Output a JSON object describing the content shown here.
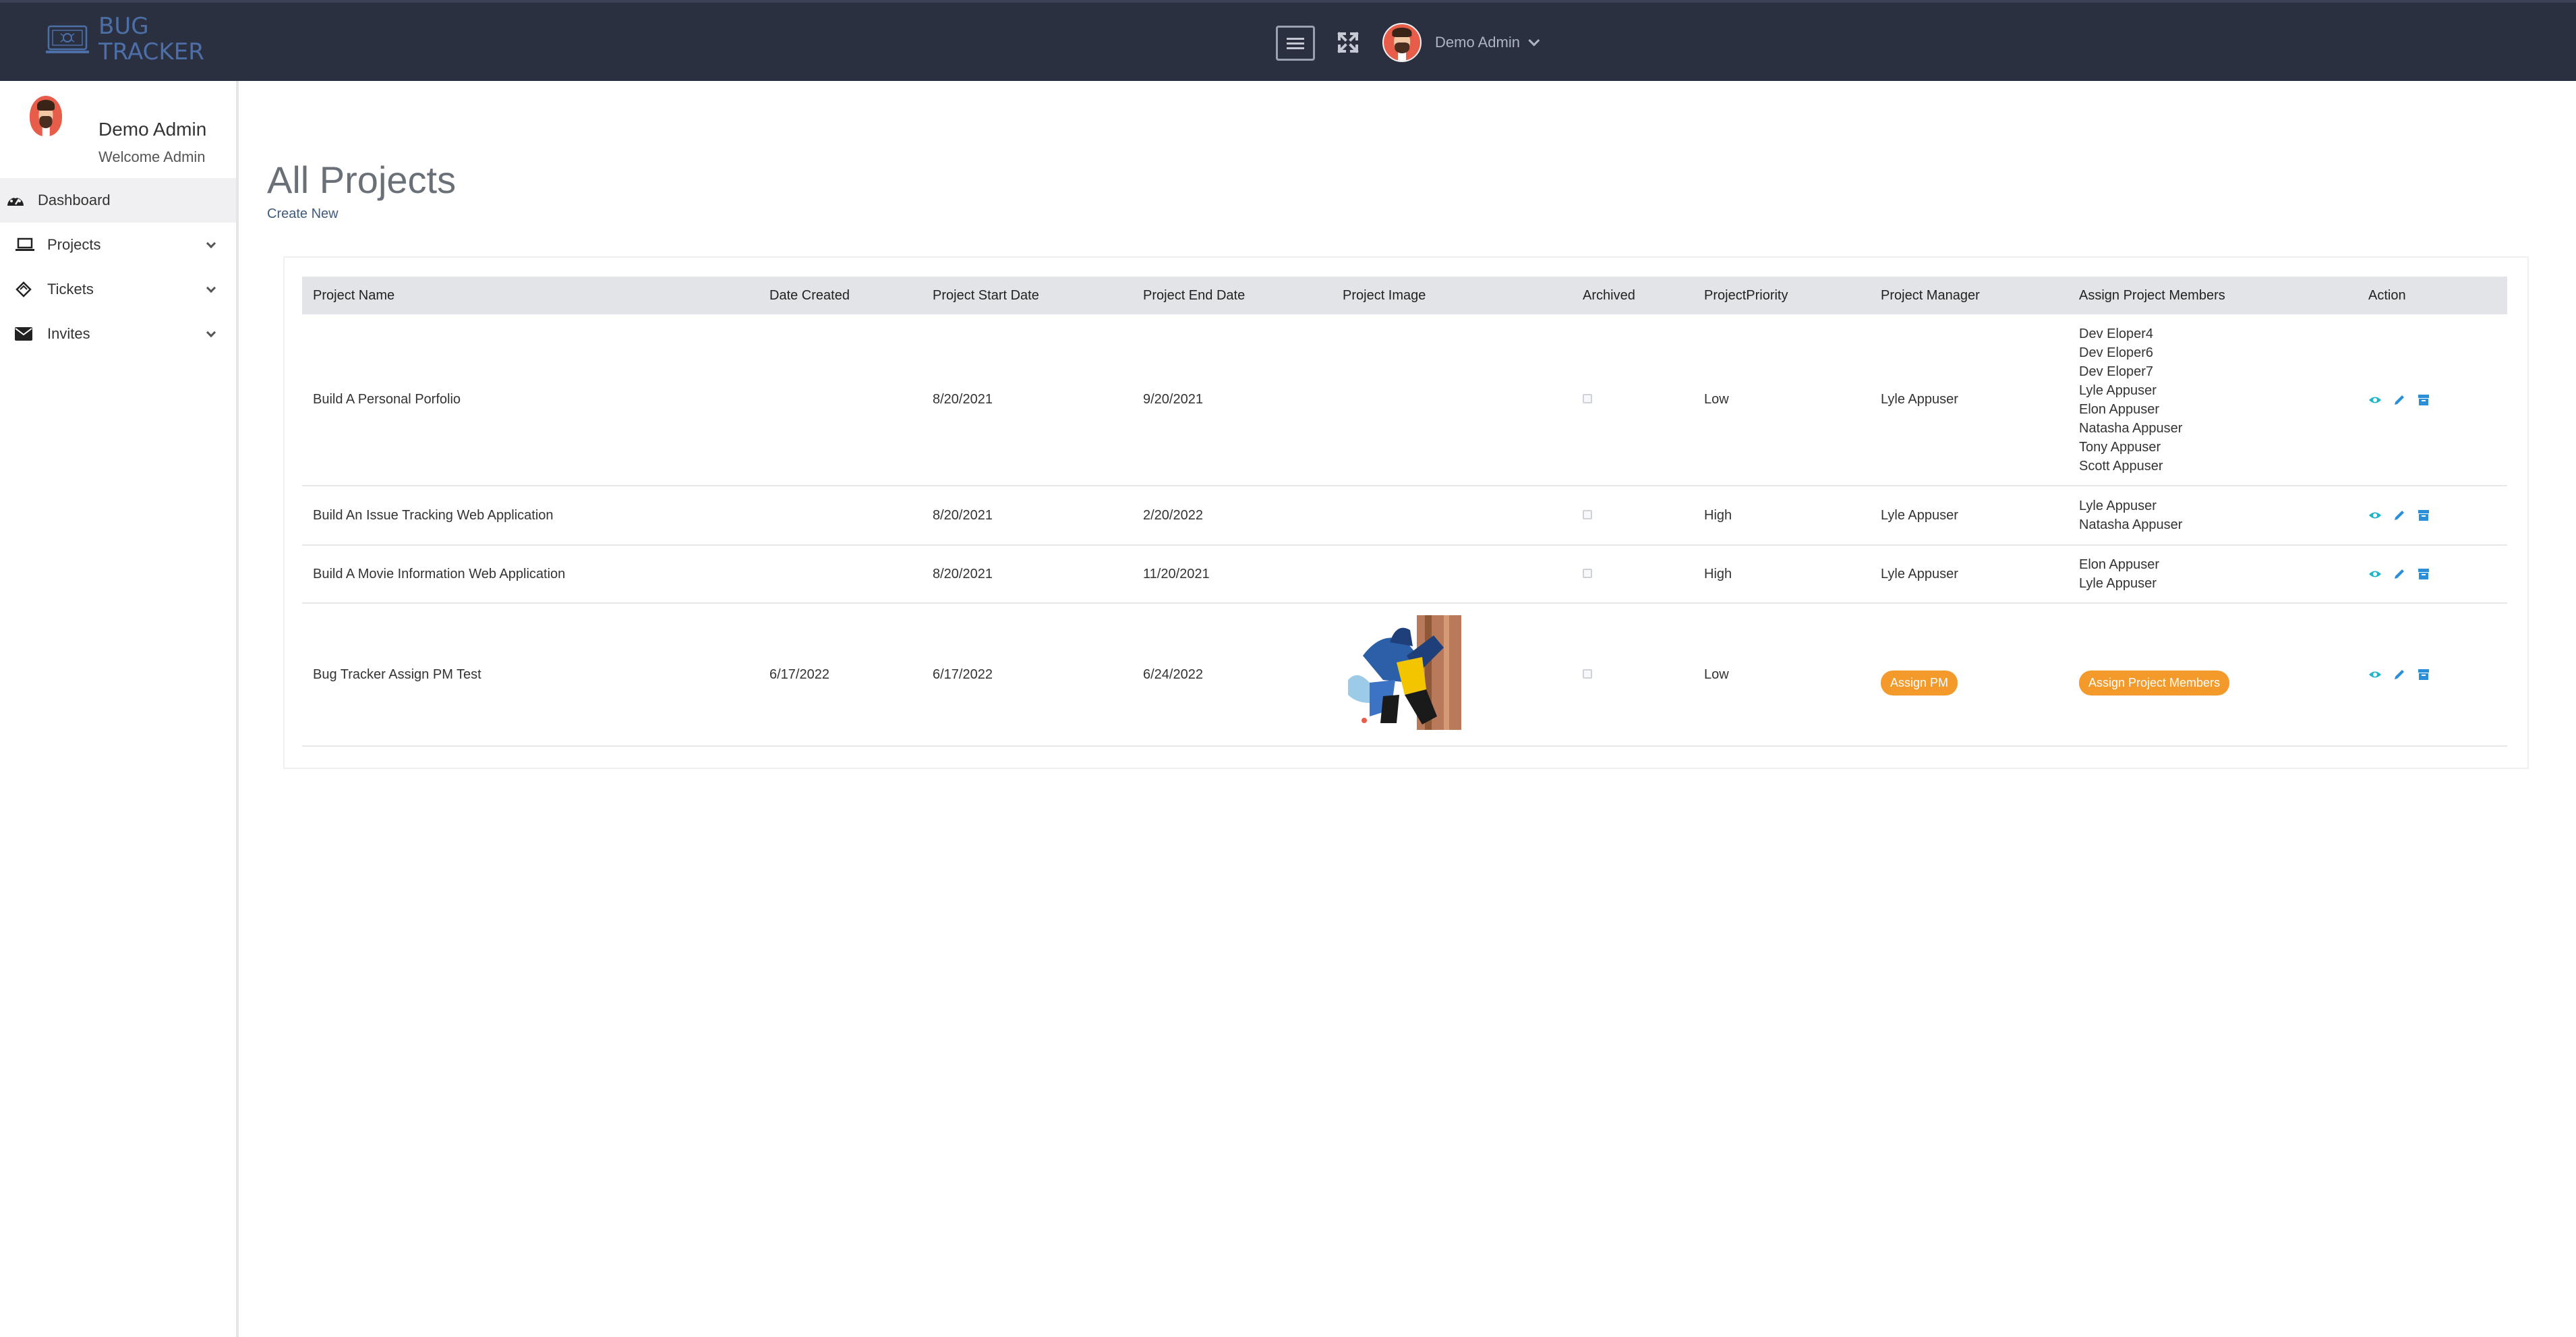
{
  "app": {
    "brand_line1": "BUG",
    "brand_line2": "TRACKER",
    "brand_icon": "bug-tracker-logo-icon"
  },
  "topbar": {
    "menu_icon": "hamburger-menu-icon",
    "fullscreen_icon": "fullscreen-icon",
    "user_name": "Demo Admin",
    "user_caret_icon": "chevron-down-icon"
  },
  "sidebar": {
    "user_name": "Demo Admin",
    "user_subtitle": "Welcome Admin",
    "items": [
      {
        "label": "Dashboard",
        "icon": "dashboard-gauge-icon",
        "active": true
      },
      {
        "label": "Projects",
        "icon": "laptop-icon",
        "expandable": true
      },
      {
        "label": "Tickets",
        "icon": "ticket-icon",
        "expandable": true
      },
      {
        "label": "Invites",
        "icon": "envelope-icon",
        "expandable": true
      }
    ]
  },
  "main": {
    "title": "All Projects",
    "create_link": "Create New",
    "table": {
      "columns": [
        "Project Name",
        "Date Created",
        "Project Start Date",
        "Project End Date",
        "Project Image",
        "Archived",
        "ProjectPriority",
        "Project Manager",
        "Assign Project Members",
        "Action"
      ],
      "rows": [
        {
          "name": "Build A Personal Porfolio",
          "created": "",
          "start": "8/20/2021",
          "end": "9/20/2021",
          "has_image": false,
          "archived": false,
          "priority": "Low",
          "manager": "Lyle Appuser",
          "members": [
            "Dev Eloper4",
            "Dev Eloper6",
            "Dev Eloper7",
            "Lyle Appuser",
            "Elon Appuser",
            "Natasha Appuser",
            "Tony Appuser",
            "Scott Appuser"
          ]
        },
        {
          "name": "Build An Issue Tracking Web Application",
          "created": "",
          "start": "8/20/2021",
          "end": "2/20/2022",
          "has_image": false,
          "archived": false,
          "priority": "High",
          "manager": "Lyle Appuser",
          "members": [
            "Lyle Appuser",
            "Natasha Appuser"
          ]
        },
        {
          "name": "Build A Movie Information Web Application",
          "created": "",
          "start": "8/20/2021",
          "end": "11/20/2021",
          "has_image": false,
          "archived": false,
          "priority": "High",
          "manager": "Lyle Appuser",
          "members": [
            "Elon Appuser",
            "Lyle Appuser"
          ]
        },
        {
          "name": "Bug Tracker Assign PM Test",
          "created": "6/17/2022",
          "start": "6/17/2022",
          "end": "6/24/2022",
          "has_image": true,
          "archived": false,
          "priority": "Low",
          "manager_badge": "Assign PM",
          "members_badge": "Assign Project Members"
        }
      ],
      "action_icons": [
        "eye-icon",
        "pencil-icon",
        "archive-box-icon"
      ]
    }
  },
  "colors": {
    "topbar": "#2b3040",
    "brand": "#4d6fa8",
    "badge": "#f39a2a",
    "action_eye": "#1fb5c9",
    "action_edit": "#2a8fd6",
    "action_archive": "#2a8fd6"
  }
}
